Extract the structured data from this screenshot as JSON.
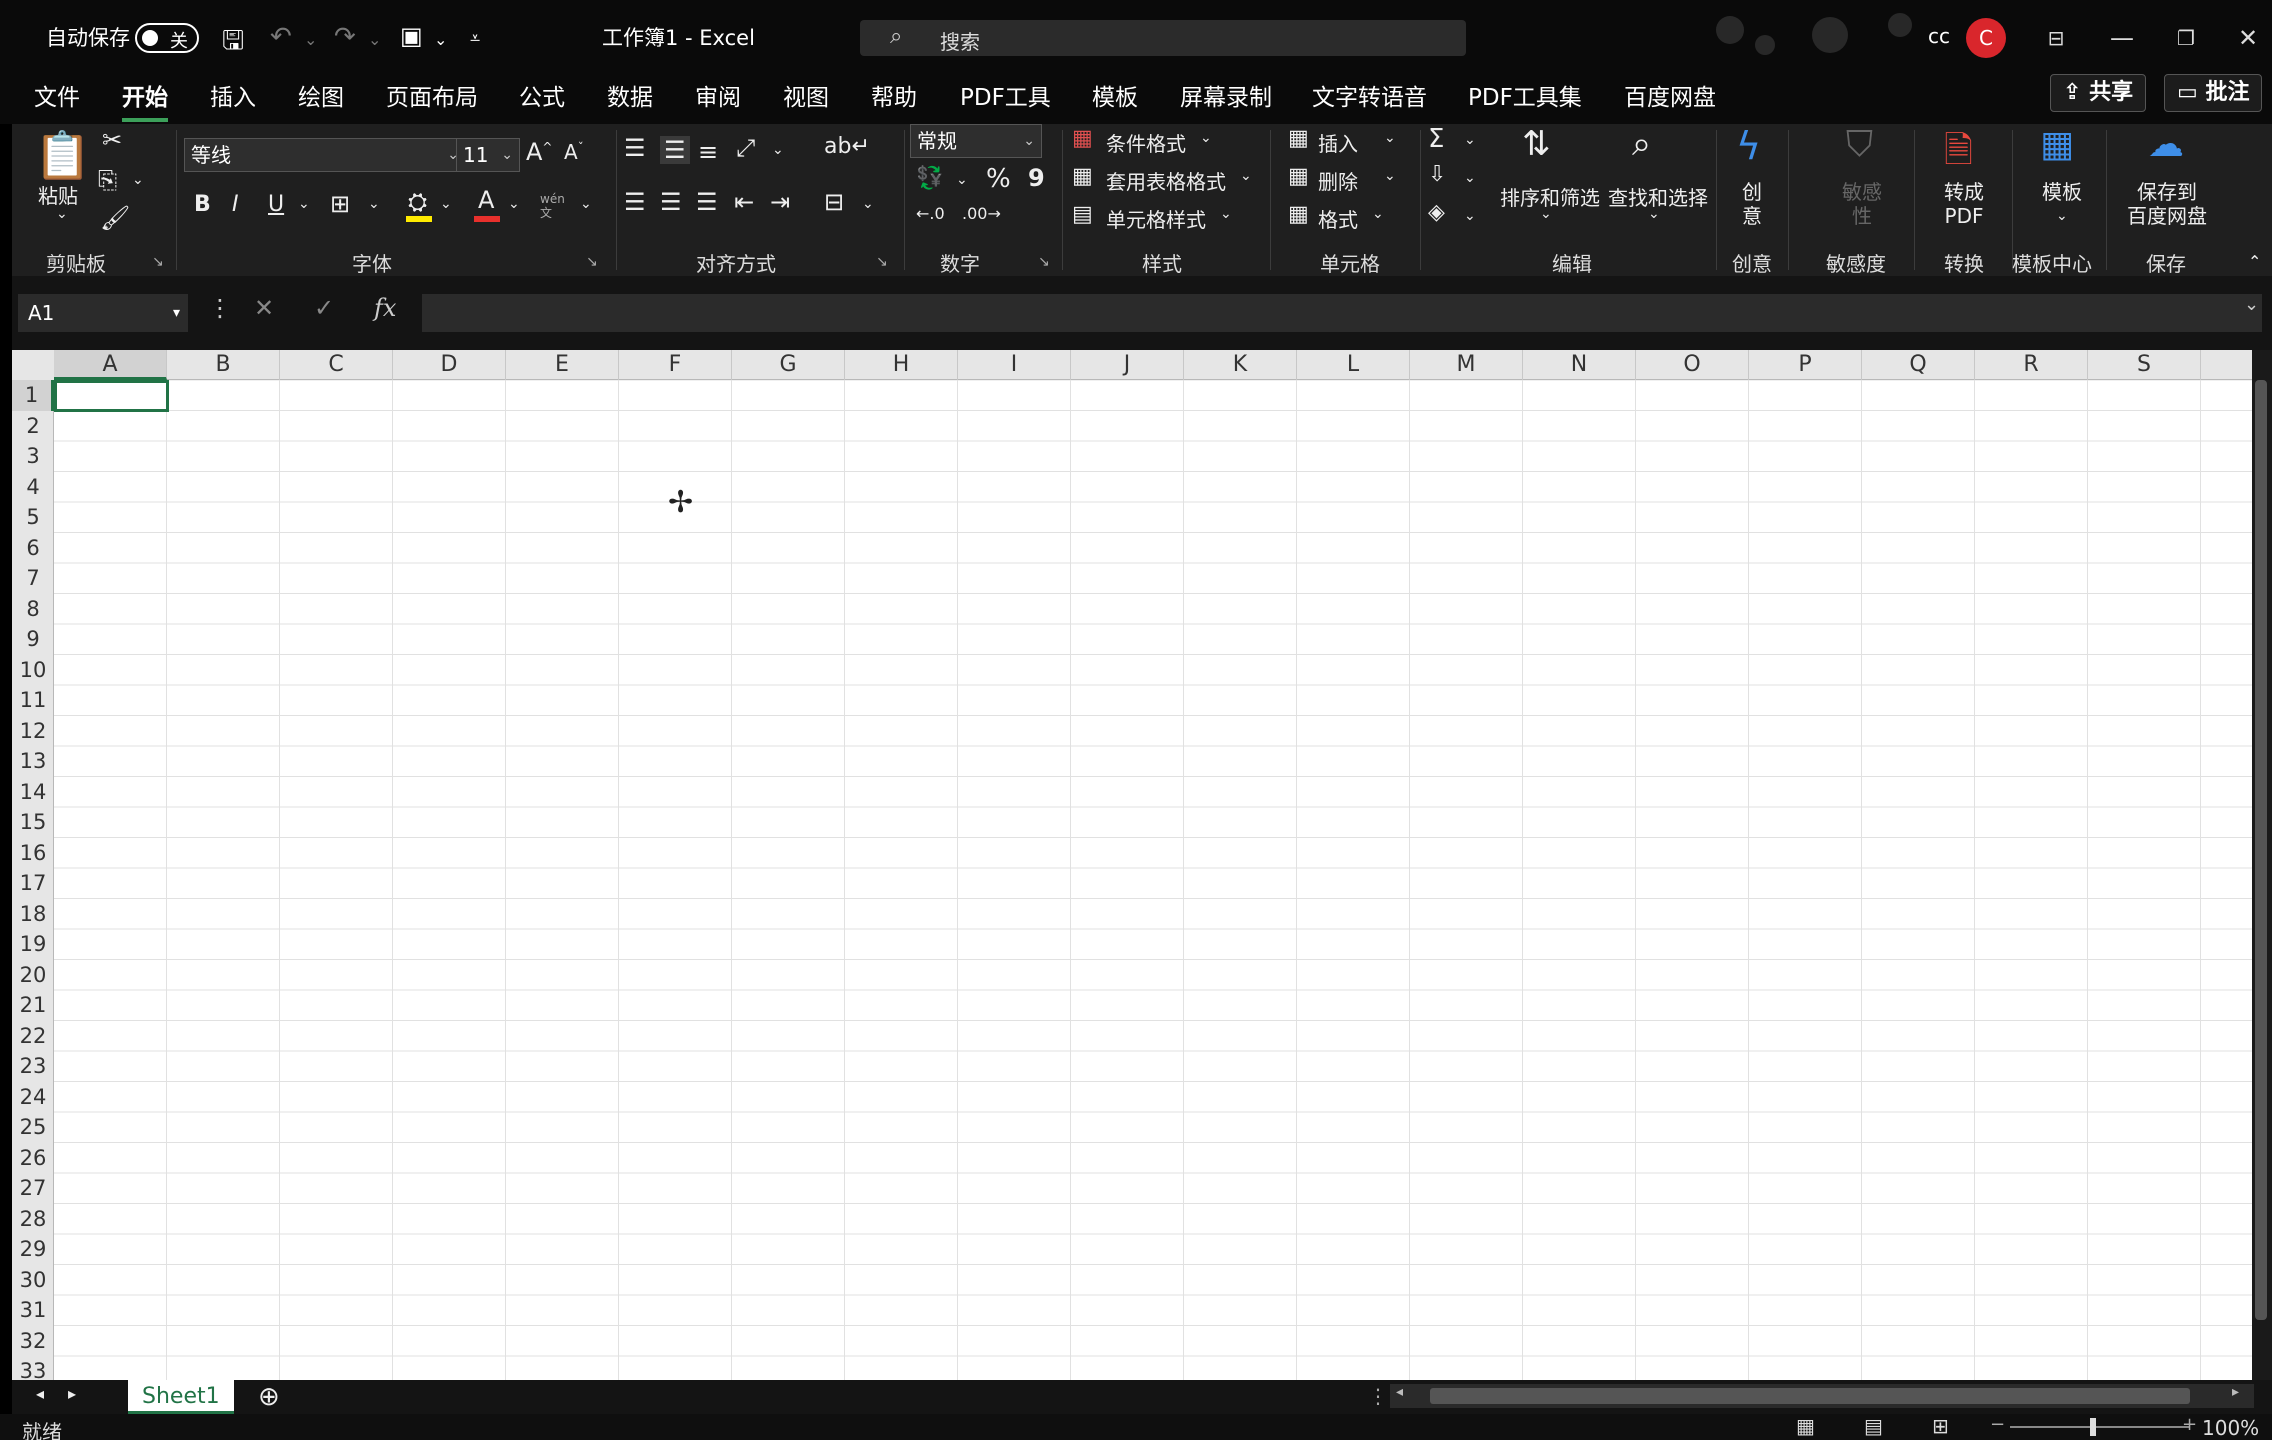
{
  "titlebar": {
    "autosave_label": "自动保存",
    "autosave_state": "关",
    "doc_title": "工作簿1  -  Excel",
    "search_placeholder": "搜索",
    "user_initials": "cc",
    "avatar_letter": "C"
  },
  "tabs": [
    "文件",
    "开始",
    "插入",
    "绘图",
    "页面布局",
    "公式",
    "数据",
    "审阅",
    "视图",
    "帮助",
    "PDF工具",
    "模板",
    "屏幕录制",
    "文字转语音",
    "PDF工具集",
    "百度网盘"
  ],
  "active_tab": "开始",
  "tab_buttons": {
    "share": "共享",
    "comment": "批注"
  },
  "ribbon": {
    "clipboard": {
      "paste": "粘贴",
      "label": "剪贴板"
    },
    "font": {
      "name": "等线",
      "size": "11",
      "bold": "B",
      "italic": "I",
      "underline": "U",
      "phonetic": "wén 文",
      "label": "字体"
    },
    "alignment": {
      "label": "对齐方式"
    },
    "number": {
      "format": "常规",
      "percent": "%",
      "comma": "9",
      "label": "数字"
    },
    "styles": {
      "conditional": "条件格式",
      "table": "套用表格格式",
      "cell": "单元格样式",
      "label": "样式"
    },
    "cells": {
      "insert": "插入",
      "delete": "删除",
      "format": "格式",
      "label": "单元格"
    },
    "editing": {
      "sort": "排序和筛选",
      "find": "查找和选择",
      "label": "编辑"
    },
    "create": {
      "btn": "创\n意",
      "label": "创意"
    },
    "sensitivity": {
      "btn": "敏感\n性",
      "label": "敏感度"
    },
    "convert": {
      "btn": "转成\nPDF",
      "label": "转换"
    },
    "template": {
      "btn": "模板",
      "label": "模板中心"
    },
    "save": {
      "btn": "保存到\n百度网盘",
      "label": "保存"
    }
  },
  "formula_bar": {
    "name_box": "A1",
    "fx": "fx",
    "value": ""
  },
  "grid": {
    "columns": [
      "A",
      "B",
      "C",
      "D",
      "E",
      "F",
      "G",
      "H",
      "I",
      "J",
      "K",
      "L",
      "M",
      "N",
      "O",
      "P",
      "Q",
      "R",
      "S"
    ],
    "rows": [
      "1",
      "2",
      "3",
      "4",
      "5",
      "6",
      "7",
      "8",
      "9",
      "10",
      "11",
      "12",
      "13",
      "14",
      "15",
      "16",
      "17",
      "18",
      "19",
      "20",
      "21",
      "22",
      "23",
      "24",
      "25",
      "26",
      "27",
      "28",
      "29",
      "30",
      "31",
      "32",
      "33"
    ],
    "selected_cell": "A1"
  },
  "sheets": [
    "Sheet1"
  ],
  "status": {
    "ready": "就绪",
    "zoom": "100%"
  },
  "colors": {
    "accent": "#217346",
    "tab_underline": "#3ca05a",
    "avatar": "#d9262c"
  }
}
